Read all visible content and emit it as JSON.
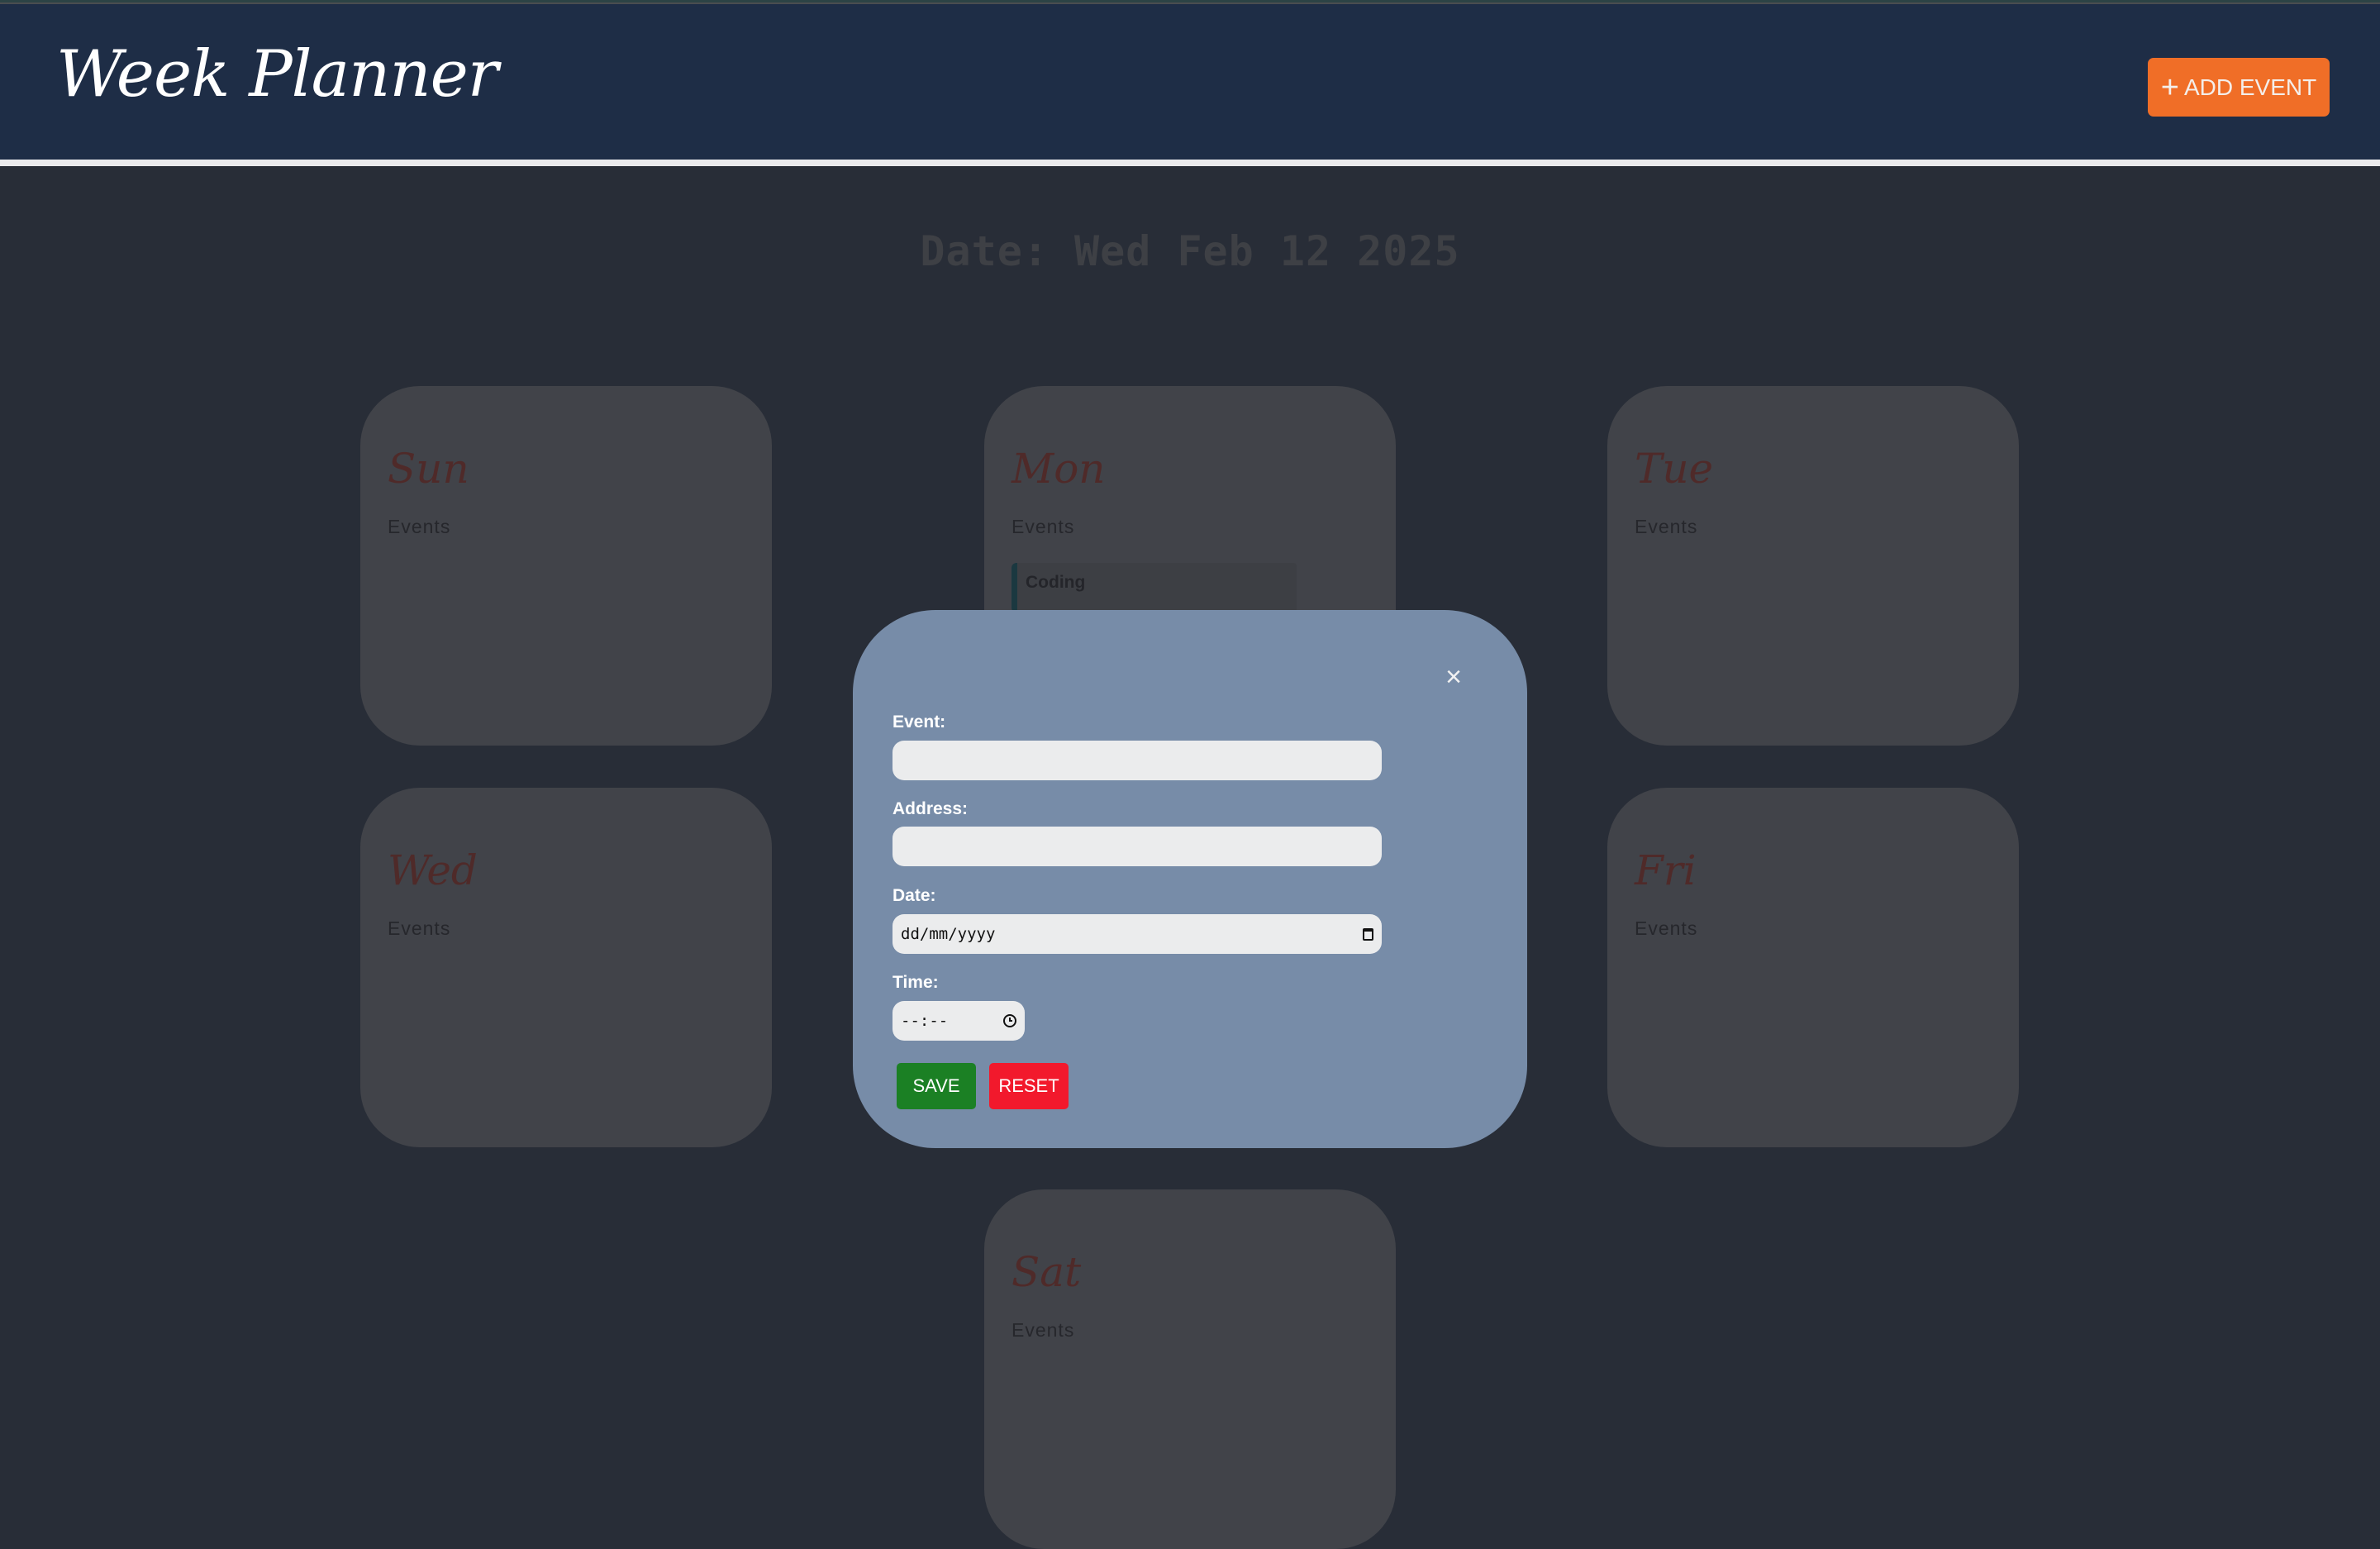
{
  "header": {
    "title": "Week Planner",
    "add_event_icon": "plus-icon",
    "add_event_plus": "+",
    "add_event_label": "ADD EVENT"
  },
  "date_display": "Date: Wed Feb 12 2025",
  "days": [
    {
      "name": "Sun",
      "events_label": "Events",
      "events": []
    },
    {
      "name": "Mon",
      "events_label": "Events",
      "events": [
        "Coding"
      ]
    },
    {
      "name": "Tue",
      "events_label": "Events",
      "events": []
    },
    {
      "name": "Wed",
      "events_label": "Events",
      "events": []
    },
    {
      "name": "Fri",
      "events_label": "Events",
      "events": []
    },
    {
      "name": "Sat",
      "events_label": "Events",
      "events": []
    }
  ],
  "modal": {
    "close_label": "×",
    "fields": {
      "event": {
        "label": "Event:",
        "value": ""
      },
      "address": {
        "label": "Address:",
        "value": ""
      },
      "date": {
        "label": "Date:",
        "placeholder": "dd/mm/yyyy",
        "icon": "calendar-icon"
      },
      "time": {
        "label": "Time:",
        "placeholder": "--:--",
        "icon": "clock-icon"
      }
    },
    "save_label": "SAVE",
    "reset_label": "RESET"
  },
  "colors": {
    "header_bg": "#1e2d46",
    "accent_orange": "#f06e27",
    "modal_bg": "#778ca8",
    "save_green": "#1b8024",
    "reset_red": "#f2192c",
    "page_bg": "#282d37",
    "card_bg": "#414349",
    "day_name": "#4f2a29"
  }
}
